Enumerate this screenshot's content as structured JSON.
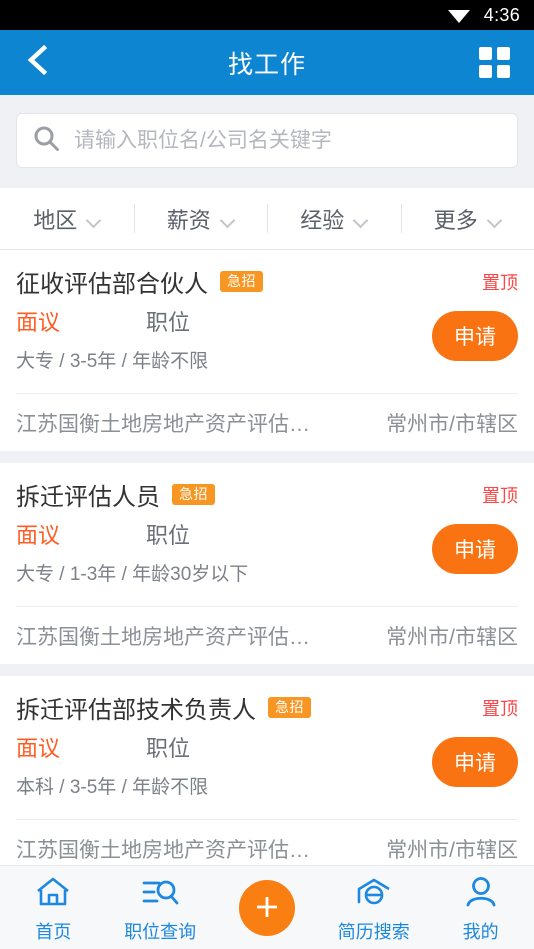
{
  "statusbar": {
    "time": "4:36",
    "wifi_icon": "wifi-icon"
  },
  "appbar": {
    "title": "找工作",
    "back_icon": "chevron-left-icon",
    "grid_icon": "grid-menu-icon"
  },
  "search": {
    "placeholder": "请输入职位名/公司名关键字",
    "value": "",
    "icon": "search-icon"
  },
  "filters": [
    {
      "label": "地区",
      "icon": "chevron-down-icon"
    },
    {
      "label": "薪资",
      "icon": "chevron-down-icon"
    },
    {
      "label": "经验",
      "icon": "chevron-down-icon"
    },
    {
      "label": "更多",
      "icon": "chevron-down-icon"
    }
  ],
  "jobs": [
    {
      "title": "征收评估部合伙人",
      "badge": "急招",
      "top_flag": "置顶",
      "pay": "面议",
      "kind": "职位",
      "apply": "申请",
      "requirements": "大专 / 3-5年 / 年龄不限",
      "company": "江苏国衡土地房地产资产评估…",
      "location": "常州市/市辖区"
    },
    {
      "title": "拆迁评估人员",
      "badge": "急招",
      "top_flag": "置顶",
      "pay": "面议",
      "kind": "职位",
      "apply": "申请",
      "requirements": "大专 / 1-3年 / 年龄30岁以下",
      "company": "江苏国衡土地房地产资产评估…",
      "location": "常州市/市辖区"
    },
    {
      "title": "拆迁评估部技术负责人",
      "badge": "急招",
      "top_flag": "置顶",
      "pay": "面议",
      "kind": "职位",
      "apply": "申请",
      "requirements": "本科 / 3-5年 / 年龄不限",
      "company": "江苏国衡土地房地产资产评估…",
      "location": "常州市/市辖区"
    }
  ],
  "tabbar": {
    "items": [
      {
        "label": "首页",
        "icon": "home-icon"
      },
      {
        "label": "职位查询",
        "icon": "job-search-icon"
      },
      {
        "label": "简历搜索",
        "icon": "resume-search-icon"
      },
      {
        "label": "我的",
        "icon": "person-icon"
      }
    ],
    "fab_icon": "plus-icon"
  },
  "colors": {
    "header_blue": "#0d85d1",
    "accent_orange": "#fa7312",
    "badge_orange": "#f79622",
    "pay_orange": "#ff5c23",
    "top_red": "#ff4646",
    "nav_blue": "#1d88e0",
    "page_bg": "#f0f1f4"
  }
}
